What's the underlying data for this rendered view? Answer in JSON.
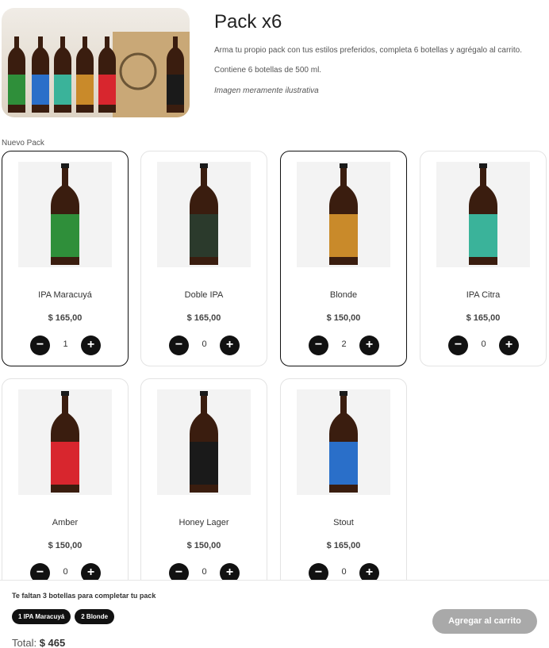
{
  "pack": {
    "title": "Pack x6",
    "description": "Arma tu propio pack con tus estilos preferidos, completa 6 botellas y agrégalo al carrito.",
    "contents": "Contiene 6 botellas de 500 ml.",
    "note": "Imagen meramente ilustrativa"
  },
  "section_label": "Nuevo Pack",
  "products": [
    {
      "name": "IPA Maracuyá",
      "price": "$ 165,00",
      "qty": "1",
      "label_color": "#2f8f3a",
      "selected": true
    },
    {
      "name": "Doble IPA",
      "price": "$ 165,00",
      "qty": "0",
      "label_color": "#2b3a2c",
      "selected": false
    },
    {
      "name": "Blonde",
      "price": "$ 150,00",
      "qty": "2",
      "label_color": "#c98a2a",
      "selected": true
    },
    {
      "name": "IPA Citra",
      "price": "$ 165,00",
      "qty": "0",
      "label_color": "#3ab39a",
      "selected": false
    },
    {
      "name": "Amber",
      "price": "$ 150,00",
      "qty": "0",
      "label_color": "#d8262e",
      "selected": false
    },
    {
      "name": "Honey Lager",
      "price": "$ 150,00",
      "qty": "0",
      "label_color": "#1a1a1a",
      "selected": false
    },
    {
      "name": "Stout",
      "price": "$ 165,00",
      "qty": "0",
      "label_color": "#2a6fc9",
      "selected": false
    }
  ],
  "qty_controls": {
    "minus": "−",
    "plus": "+"
  },
  "footer": {
    "remaining": "Te faltan 3 botellas para completar tu pack",
    "chips": [
      "1 IPA Maracuyá",
      "2 Blonde"
    ],
    "total_label": "Total:",
    "total_value": "$ 465",
    "add_to_cart": "Agregar al carrito"
  }
}
